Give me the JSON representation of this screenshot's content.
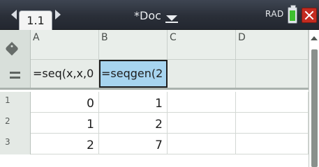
{
  "titlebar": {
    "tab_label": "1.1",
    "doc_title": "*Doc",
    "mode": "RAD"
  },
  "columns": [
    "A",
    "B",
    "C",
    "D"
  ],
  "formulas": [
    "=seq(x,x,0",
    "=seqgen(2",
    "",
    ""
  ],
  "rows": [
    {
      "num": "1",
      "cells": [
        "0",
        "1",
        "",
        ""
      ]
    },
    {
      "num": "2",
      "cells": [
        "1",
        "2",
        "",
        ""
      ]
    },
    {
      "num": "3",
      "cells": [
        "2",
        "7",
        "",
        ""
      ]
    }
  ],
  "icons": {
    "prev_page": "triangle-left-icon",
    "next_page": "triangle-right-icon",
    "doc_menu": "chevron-down-icon",
    "battery": "battery-icon",
    "close": "close-icon",
    "column_tag": "tag-icon",
    "formula_row": "equals-icon"
  },
  "colors": {
    "titlebar": "#2a2f38",
    "selected_cell": "#a7d4ef",
    "close_button": "#c42b20",
    "battery_level": "#3fbf2f"
  }
}
